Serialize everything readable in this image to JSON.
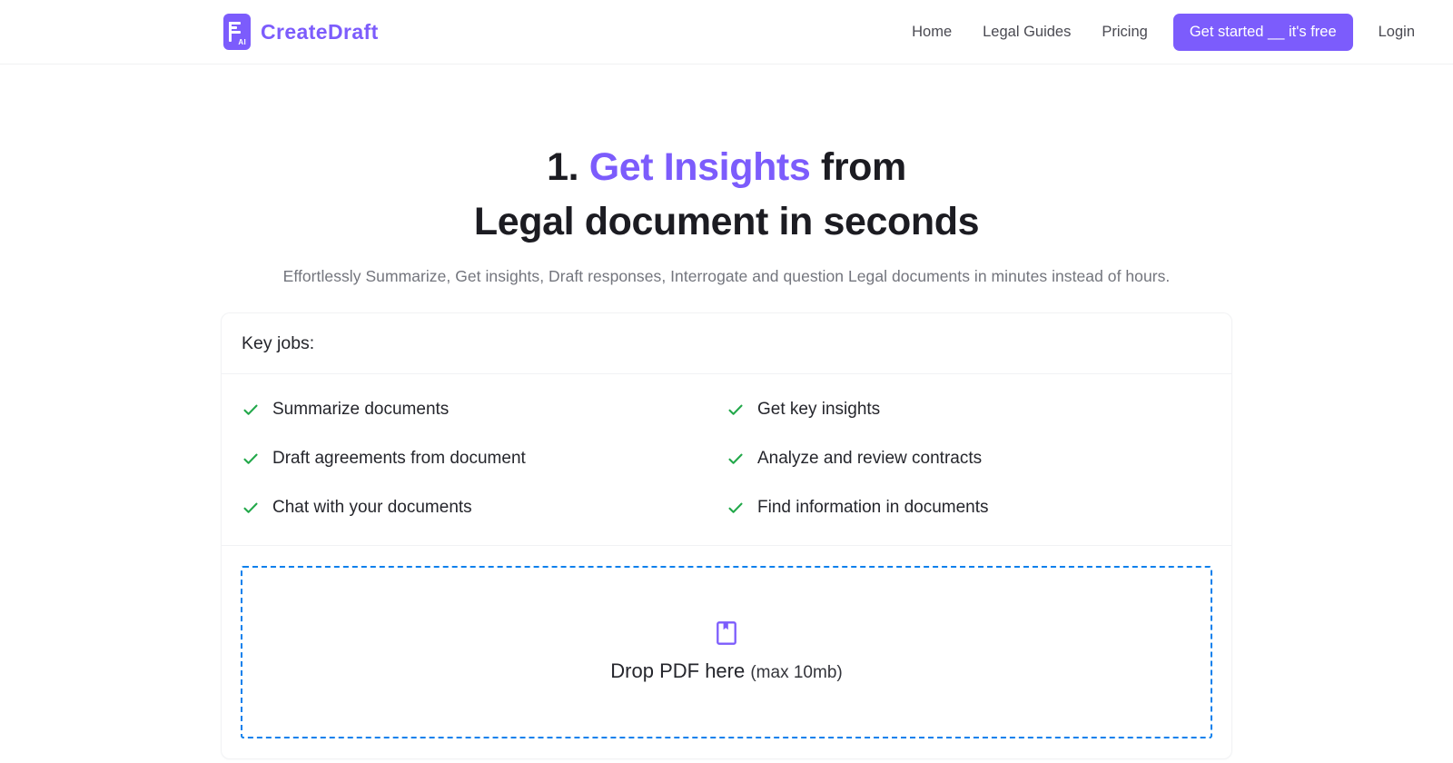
{
  "header": {
    "brand": {
      "name": "CreateDraft",
      "badge": "AI",
      "icon": "document-ai-logo-icon"
    },
    "nav": [
      {
        "label": "Home",
        "name": "nav-link-home"
      },
      {
        "label": "Legal Guides",
        "name": "nav-link-legal-guides"
      },
      {
        "label": "Pricing",
        "name": "nav-link-pricing"
      }
    ],
    "cta_label": "Get started __ it's free",
    "login_label": "Login",
    "accent_color": "#7c5cfc"
  },
  "hero": {
    "headline_prefix": "1. ",
    "headline_accent": "Get Insights",
    "headline_suffix": " from",
    "headline_line2": "Legal document in seconds",
    "subhead": "Effortlessly Summarize, Get insights, Draft responses, Interrogate and question Legal documents in minutes instead of hours."
  },
  "card": {
    "title": "Key jobs:",
    "jobs": [
      {
        "label": "Summarize documents"
      },
      {
        "label": "Get key insights"
      },
      {
        "label": "Draft agreements from document"
      },
      {
        "label": "Analyze and review contracts"
      },
      {
        "label": "Chat with your documents"
      },
      {
        "label": "Find information in documents"
      }
    ],
    "check_color": "#22a84a",
    "dropzone": {
      "icon": "book-bookmark-icon",
      "text": "Drop PDF here",
      "hint": "(max 10mb)",
      "border_color": "#0d80ec"
    }
  }
}
